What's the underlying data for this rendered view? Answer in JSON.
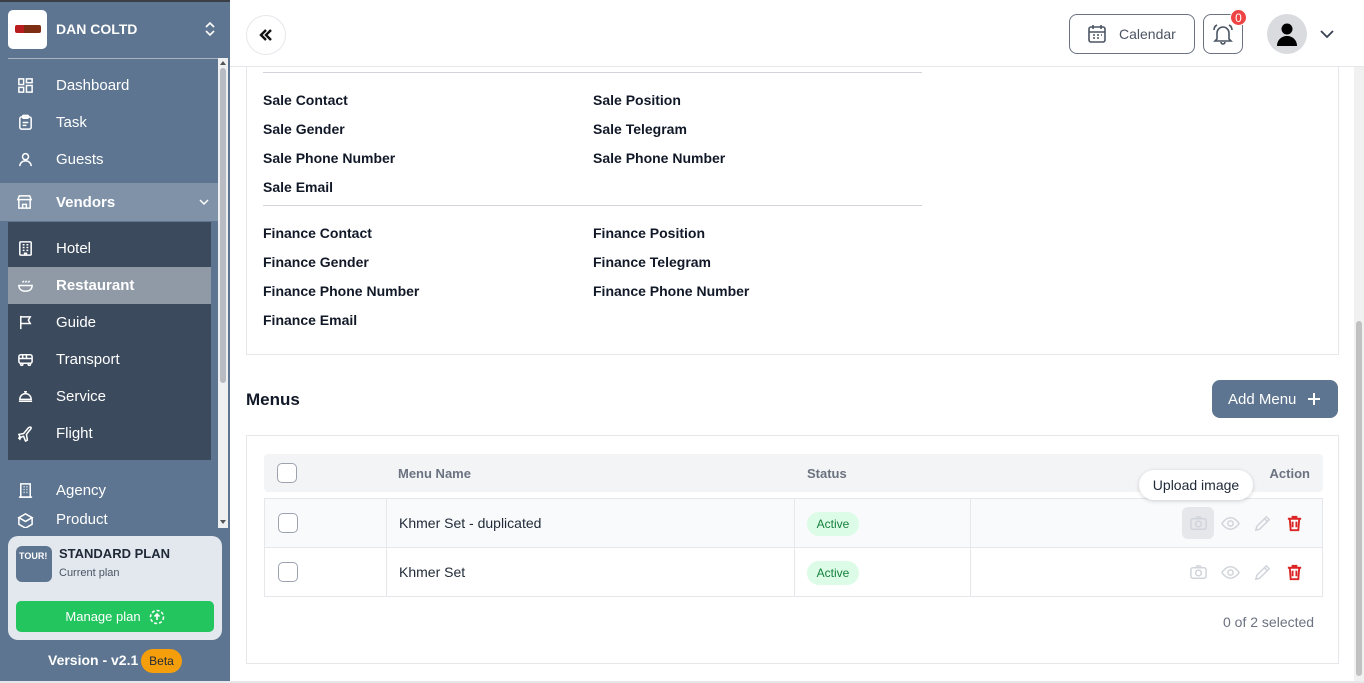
{
  "company": {
    "name": "DAN COLTD"
  },
  "sidebar": {
    "items": [
      {
        "label": "Dashboard",
        "icon": "grid-icon"
      },
      {
        "label": "Task",
        "icon": "clipboard-icon"
      },
      {
        "label": "Guests",
        "icon": "user-icon"
      }
    ],
    "vendors": {
      "label": "Vendors",
      "icon": "store-icon",
      "sub_items": [
        {
          "label": "Hotel",
          "icon": "building-icon"
        },
        {
          "label": "Restaurant",
          "icon": "bowl-icon",
          "active": true
        },
        {
          "label": "Guide",
          "icon": "flag-icon"
        },
        {
          "label": "Transport",
          "icon": "bus-icon"
        },
        {
          "label": "Service",
          "icon": "bellhop-icon"
        },
        {
          "label": "Flight",
          "icon": "plane-icon"
        }
      ]
    },
    "after": [
      {
        "label": "Agency",
        "icon": "office-icon"
      },
      {
        "label": "Product",
        "icon": "box-icon"
      }
    ]
  },
  "plan": {
    "logo_text": "TOUR!",
    "title": "STANDARD PLAN",
    "subtitle": "Current plan",
    "button": "Manage plan"
  },
  "version": {
    "label": "Version - v2.1",
    "badge": "Beta"
  },
  "header": {
    "calendar_label": "Calendar",
    "notification_count": "0"
  },
  "contacts": {
    "sale": {
      "left": [
        "Sale Contact",
        "Sale Gender",
        "Sale Phone Number",
        "Sale Email"
      ],
      "right": [
        "Sale Position",
        "Sale Telegram",
        "Sale Phone Number"
      ]
    },
    "finance": {
      "left": [
        "Finance Contact",
        "Finance Gender",
        "Finance Phone Number",
        "Finance Email"
      ],
      "right": [
        "Finance Position",
        "Finance Telegram",
        "Finance Phone Number"
      ]
    }
  },
  "menus": {
    "title": "Menus",
    "add_button": "Add Menu",
    "columns": {
      "name": "Menu Name",
      "status": "Status",
      "action": "Action"
    },
    "rows": [
      {
        "name": "Khmer Set - duplicated",
        "status": "Active"
      },
      {
        "name": "Khmer Set",
        "status": "Active"
      }
    ],
    "tooltip": "Upload image",
    "selected_text": "0 of 2 selected"
  },
  "colors": {
    "sidebar": "#5d7590",
    "submenu": "#3b4a5c",
    "accent_green": "#22c55e",
    "danger": "#dc2626",
    "badge": "#ef4444",
    "beta": "#f59e0b"
  }
}
